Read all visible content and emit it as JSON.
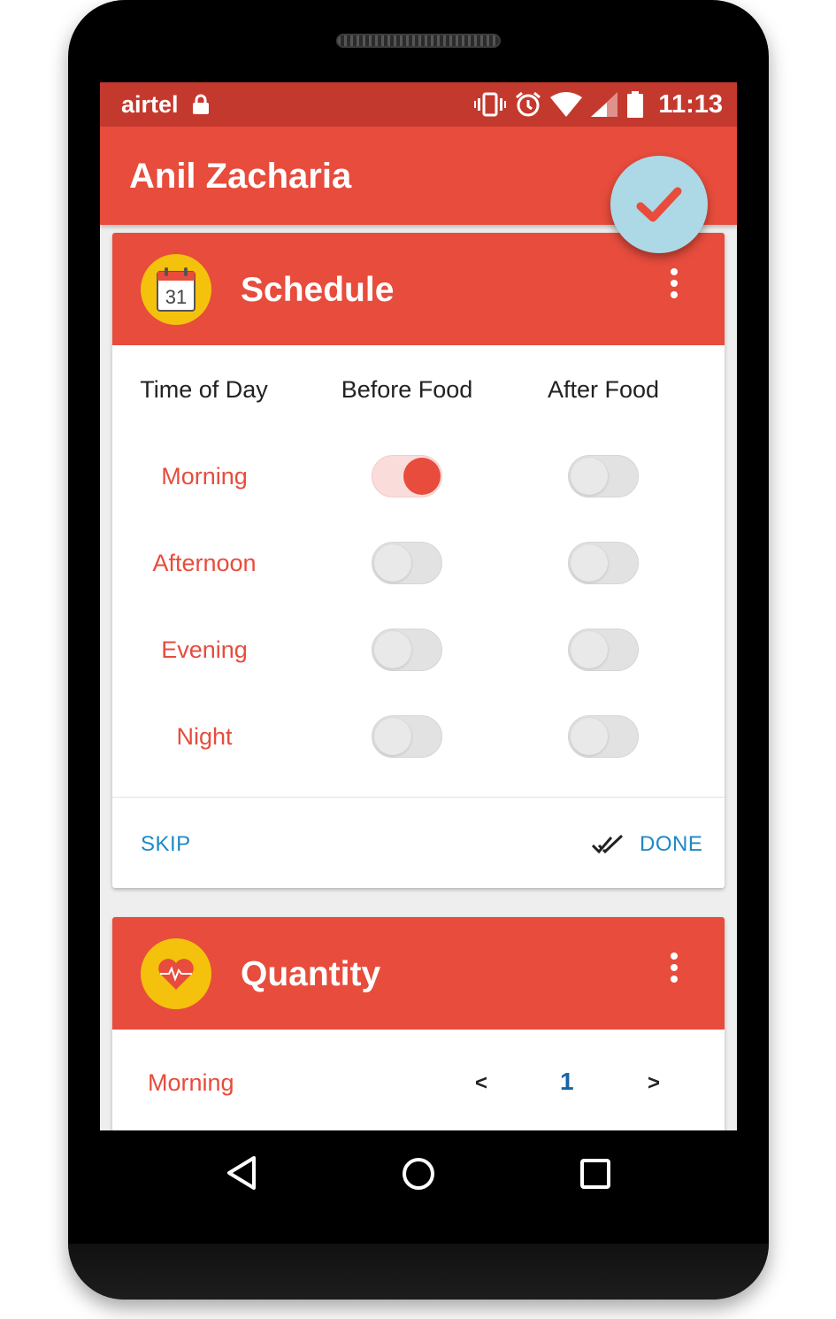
{
  "status_bar": {
    "carrier": "airtel",
    "time": "11:13"
  },
  "app_bar": {
    "title": "Anil Zacharia"
  },
  "fab": {
    "icon": "check-icon"
  },
  "schedule_card": {
    "title": "Schedule",
    "avatar_icon": "calendar-icon",
    "calendar_day": "31",
    "columns": [
      "Time of Day",
      "Before Food",
      "After Food"
    ],
    "rows": [
      {
        "label": "Morning",
        "before_food": true,
        "after_food": false
      },
      {
        "label": "Afternoon",
        "before_food": false,
        "after_food": false
      },
      {
        "label": "Evening",
        "before_food": false,
        "after_food": false
      },
      {
        "label": "Night",
        "before_food": false,
        "after_food": false
      }
    ],
    "skip_label": "SKIP",
    "done_label": "DONE"
  },
  "quantity_card": {
    "title": "Quantity",
    "avatar_icon": "heart-pulse-icon",
    "rows": [
      {
        "label": "Morning",
        "decrement": "<",
        "value": "1",
        "increment": ">"
      }
    ]
  },
  "colors": {
    "primary": "#e74c3c",
    "status_bar": "#c4392d",
    "fab": "#add8e6",
    "accent_text": "#1e88c7",
    "avatar": "#f4c20d"
  }
}
